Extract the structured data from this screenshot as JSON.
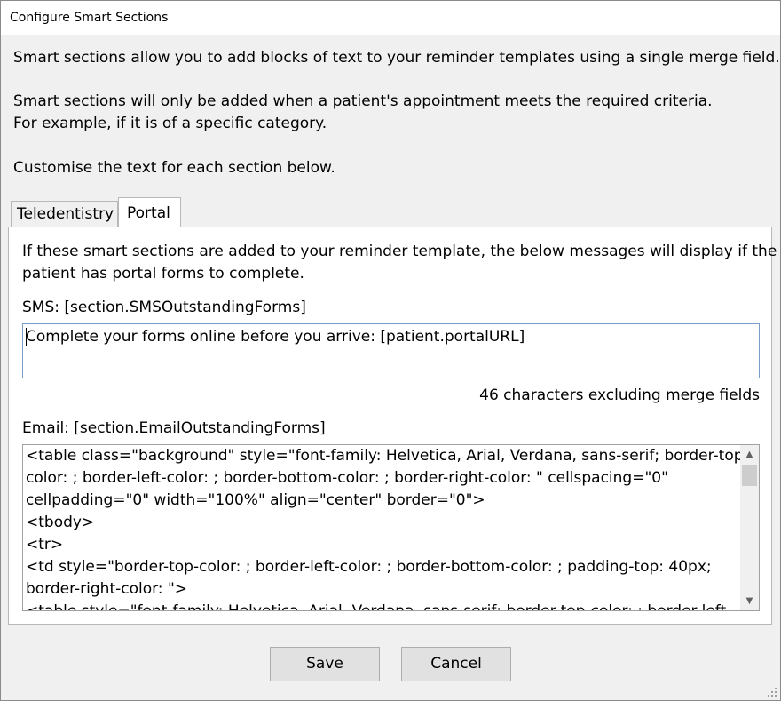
{
  "window": {
    "title": "Configure Smart Sections"
  },
  "intro": {
    "line1": "Smart sections allow you to add blocks of text to your reminder templates using a single merge field.",
    "line2": "Smart sections will only be added when a patient's appointment meets the required criteria.",
    "line3": "For example, if it is of a specific category.",
    "line4": "Customise the text for each section below."
  },
  "tabs": [
    {
      "label": "Teledentistry",
      "selected": false
    },
    {
      "label": "Portal",
      "selected": true
    }
  ],
  "panel": {
    "desc1": "If these smart sections are added to your reminder template, the below messages will display if the",
    "desc2": "patient has portal forms to complete.",
    "sms_label": "SMS: [section.SMSOutstandingForms]",
    "sms_value": "Complete your forms online before you arrive: [patient.portalURL]",
    "char_count": "46 characters excluding merge fields",
    "email_label": "Email: [section.EmailOutstandingForms]",
    "email_lines": [
      "<table class=\"background\" style=\"font-family: Helvetica, Arial, Verdana, sans-serif; border-top-",
      "color: ; border-left-color: ; border-bottom-color: ; border-right-color: \" cellspacing=\"0\"",
      "cellpadding=\"0\" width=\"100%\" align=\"center\" border=\"0\">",
      "<tbody>",
      "<tr>",
      "<td style=\"border-top-color: ; border-left-color: ; border-bottom-color: ; padding-top: 40px;",
      "border-right-color: \">",
      "<table style=\"font-family: Helvetica, Arial, Verdana, sans-serif; border-top-color: ; border-left-"
    ]
  },
  "buttons": {
    "save": "Save",
    "cancel": "Cancel"
  }
}
